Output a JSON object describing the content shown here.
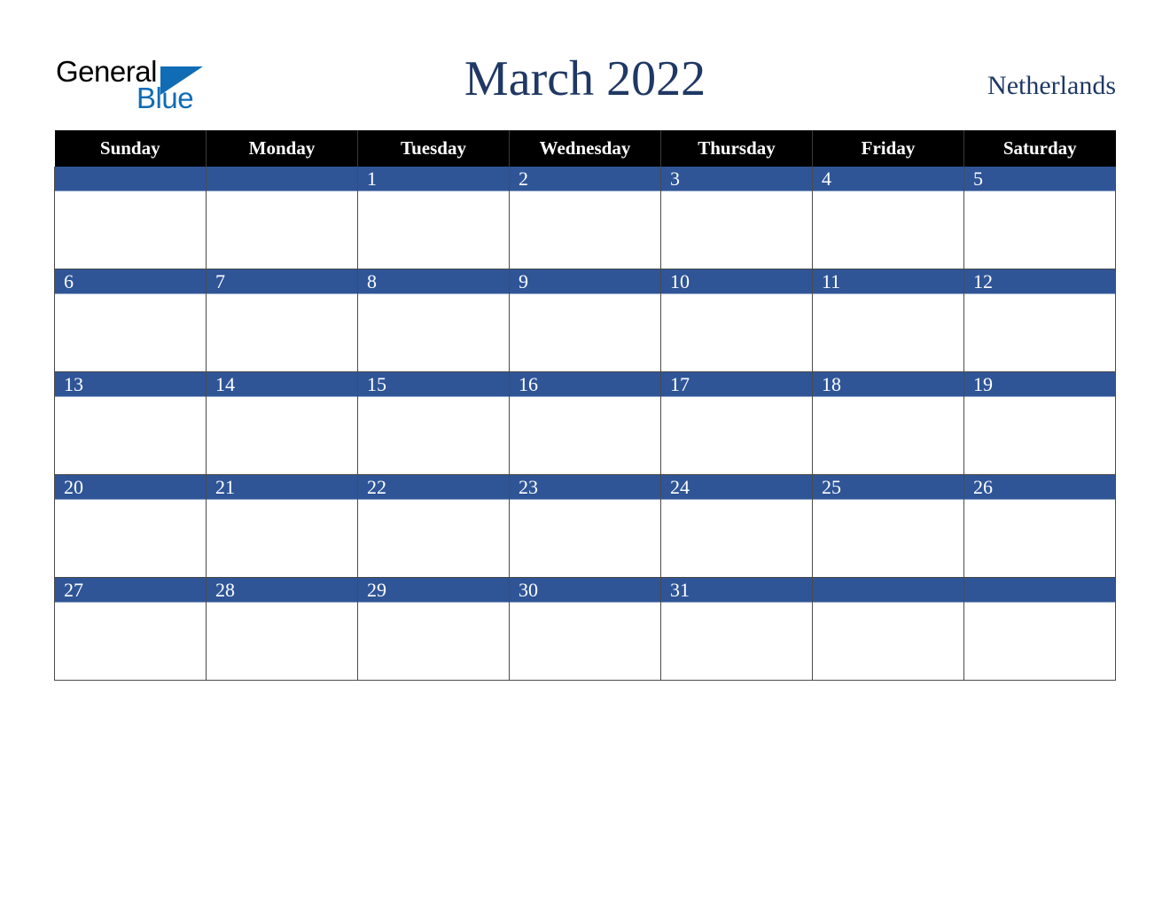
{
  "logo": {
    "word_one": "General",
    "word_two": "Blue",
    "triangle_icon": "triangle-icon",
    "blue_hex": "#0f6cb5",
    "black_hex": "#000000"
  },
  "header": {
    "title": "March 2022",
    "country": "Netherlands",
    "title_color": "#1f3864"
  },
  "calendar": {
    "month": "March",
    "year": "2022",
    "accent_hex": "#2f5597",
    "header_bg_hex": "#000000",
    "weekday_headers": [
      "Sunday",
      "Monday",
      "Tuesday",
      "Wednesday",
      "Thursday",
      "Friday",
      "Saturday"
    ],
    "weeks": [
      [
        "",
        "",
        "1",
        "2",
        "3",
        "4",
        "5"
      ],
      [
        "6",
        "7",
        "8",
        "9",
        "10",
        "11",
        "12"
      ],
      [
        "13",
        "14",
        "15",
        "16",
        "17",
        "18",
        "19"
      ],
      [
        "20",
        "21",
        "22",
        "23",
        "24",
        "25",
        "26"
      ],
      [
        "27",
        "28",
        "29",
        "30",
        "31",
        "",
        ""
      ]
    ]
  }
}
